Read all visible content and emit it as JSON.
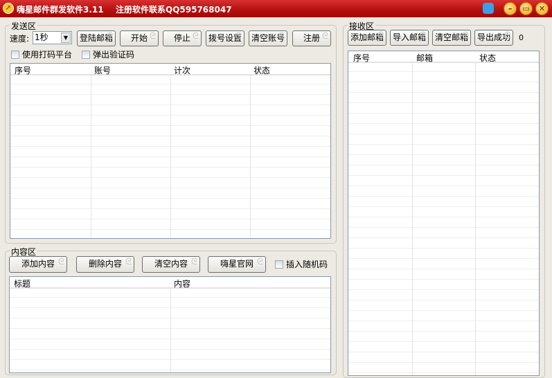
{
  "window": {
    "title": "嗨星邮件群发软件3.11",
    "contact": "注册软件联系QQ595768047",
    "minimize": "–",
    "maximize": "▭",
    "close": "✕"
  },
  "send": {
    "label": "发送区",
    "speed_label": "速度:",
    "speed_value": "1秒",
    "buttons": [
      "登陆邮箱",
      "开始",
      "停止",
      "拨号设置",
      "清空账号",
      "注册"
    ],
    "checkboxes": [
      "使用打码平台",
      "弹出验证码"
    ],
    "columns": [
      "序号",
      "账号",
      "计次",
      "状态"
    ]
  },
  "content": {
    "label": "内容区",
    "buttons": [
      "添加内容",
      "删除内容",
      "清空内容",
      "嗨星官网"
    ],
    "checkbox": "插入随机码",
    "columns": [
      "标题",
      "内容"
    ]
  },
  "receive": {
    "label": "接收区",
    "buttons": [
      "添加邮箱",
      "导入邮箱",
      "清空邮箱",
      "导出成功"
    ],
    "count": "0",
    "columns": [
      "序号",
      "邮箱",
      "状态"
    ]
  }
}
